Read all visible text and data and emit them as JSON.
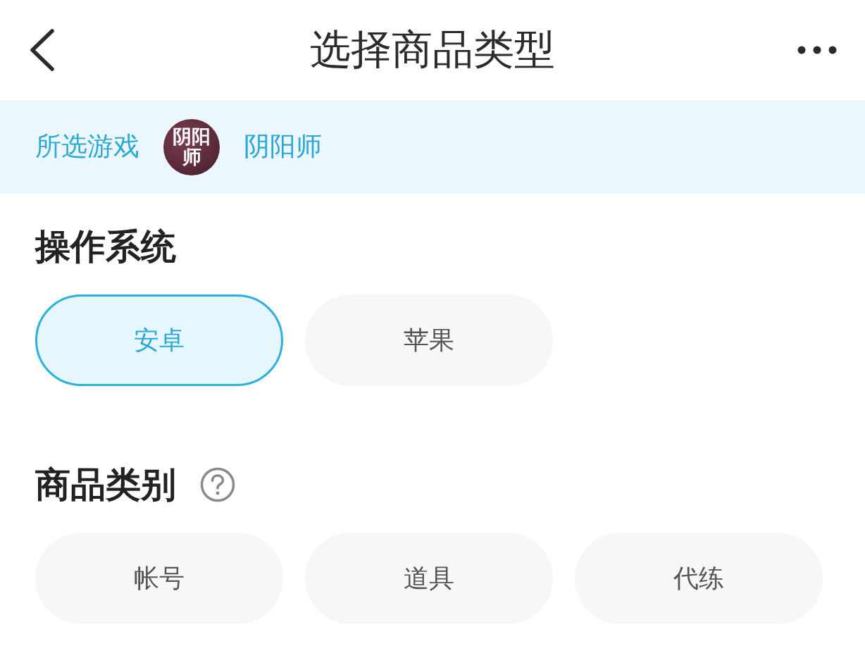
{
  "header": {
    "title": "选择商品类型"
  },
  "selected_game": {
    "label": "所选游戏",
    "logo_text": "阴阳师",
    "name": "阴阳师"
  },
  "sections": [
    {
      "title": "操作系统",
      "help": false,
      "options": [
        {
          "label": "安卓",
          "selected": true
        },
        {
          "label": "苹果",
          "selected": false
        }
      ]
    },
    {
      "title": "商品类别",
      "help": true,
      "options": [
        {
          "label": "帐号",
          "selected": false
        },
        {
          "label": "道具",
          "selected": false
        },
        {
          "label": "代练",
          "selected": false
        }
      ]
    }
  ]
}
